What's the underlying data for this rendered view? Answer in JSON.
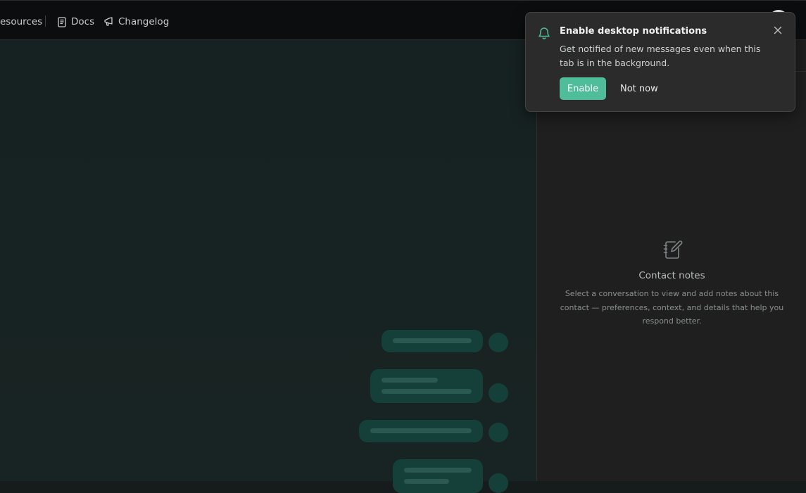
{
  "topbar": {
    "nav": [
      {
        "label": "esources",
        "icon": "none"
      },
      {
        "label": "Docs",
        "icon": "book-icon"
      },
      {
        "label": "Changelog",
        "icon": "megaphone-icon"
      }
    ]
  },
  "notification": {
    "title": "Enable desktop notifications",
    "description": "Get notified of new messages even when this tab is in the background.",
    "enable_label": "Enable",
    "dismiss_label": "Not now",
    "icon": "bell-icon",
    "accent_color": "#4fbc9a"
  },
  "notes_panel": {
    "title": "Contact notes",
    "description": "Select a conversation to view and add notes about this contact — preferences, context, and details that help you respond better.",
    "icon": "notebook-pen-icon"
  }
}
